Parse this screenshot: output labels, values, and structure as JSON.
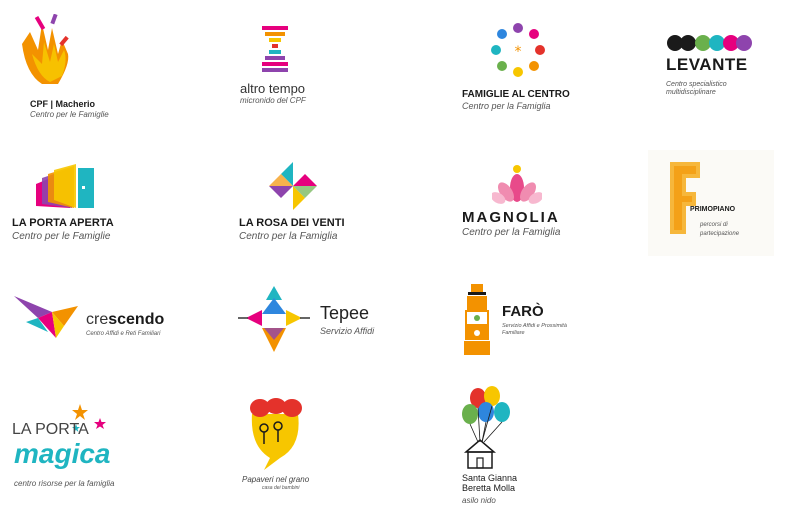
{
  "logos": {
    "cpf": {
      "name": "CPF | Macherio",
      "sub": "Centro per le Famiglie"
    },
    "altro_tempo": {
      "name": "altro tempo",
      "sub": "micronido del CPF"
    },
    "famiglie_al_centro": {
      "name": "FAMIGLIE AL CENTRO",
      "sub": "Centro per la Famiglia"
    },
    "levante": {
      "name": "LEVANTE",
      "sub1": "Centro specialistico",
      "sub2": "multidisciplinare"
    },
    "porta_aperta": {
      "name": "LA PORTA APERTA",
      "sub": "Centro per le Famiglie"
    },
    "rosa_dei_venti": {
      "name": "LA ROSA DEI VENTI",
      "sub": "Centro per la Famiglia"
    },
    "magnolia": {
      "name": "MAGNOLIA",
      "sub": "Centro per la Famiglia"
    },
    "primopiano": {
      "name": "PRIMOPIANO",
      "sub1": "percorsi di",
      "sub2": "partecipazione"
    },
    "crescendo": {
      "name_a": "cre",
      "name_b": "scendo",
      "sub": "Centro Affidi e Reti Familiari"
    },
    "tepee": {
      "name": "Tepee",
      "sub": "Servizio Affidi"
    },
    "faro": {
      "name": "FARÒ",
      "sub1": "Servizio Affidi e Prossimità",
      "sub2": "Familiare"
    },
    "porta_magica": {
      "name_a": "LA PORTA",
      "name_b": "magica",
      "sub": "centro risorse per la famiglia"
    },
    "papaveri": {
      "name": "Papaveri nel grano",
      "sub": "casa dei bambini"
    },
    "santa_gianna": {
      "line1": "Santa Gianna",
      "line2": "Beretta Molla",
      "line3": "asilo nido"
    }
  },
  "colors": {
    "orange": "#f39200",
    "pink": "#e6007e",
    "teal": "#1fb5c1",
    "purple": "#8e44ad",
    "yellow": "#f7c600",
    "red": "#e4322b",
    "green": "#6ab04c",
    "blue": "#2e86de"
  }
}
